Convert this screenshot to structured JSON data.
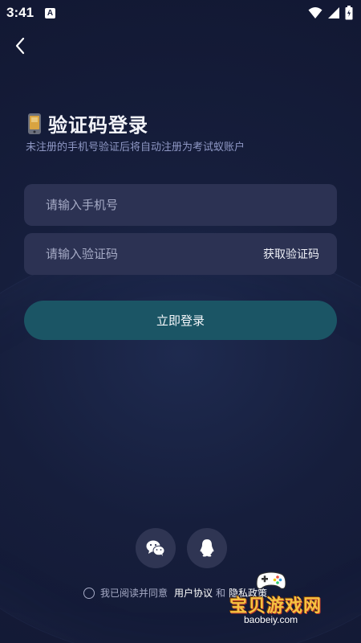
{
  "status_bar": {
    "time": "3:41",
    "app_icon_letter": "A"
  },
  "header": {
    "back_icon": "chevron-left-icon"
  },
  "title": {
    "icon": "mobile-phone-icon",
    "text": "验证码登录",
    "subtitle": "未注册的手机号验证后将自动注册为考试蚁账户"
  },
  "form": {
    "phone_placeholder": "请输入手机号",
    "phone_value": "",
    "code_placeholder": "请输入验证码",
    "code_value": "",
    "get_code_label": "获取验证码",
    "login_label": "立即登录"
  },
  "social": {
    "wechat_icon": "wechat-icon",
    "qq_icon": "qq-icon"
  },
  "agreement": {
    "prefix": "我已阅读并同意",
    "user_agreement": "用户协议",
    "and": "和",
    "privacy": "隐私政策"
  },
  "watermark": {
    "title": "宝贝游戏网",
    "url": "baobeiy.com"
  },
  "colors": {
    "background": "#161e3c",
    "input_bg": "#2c3253",
    "login_button": "#1b5565",
    "subtitle": "#8e97c4"
  }
}
